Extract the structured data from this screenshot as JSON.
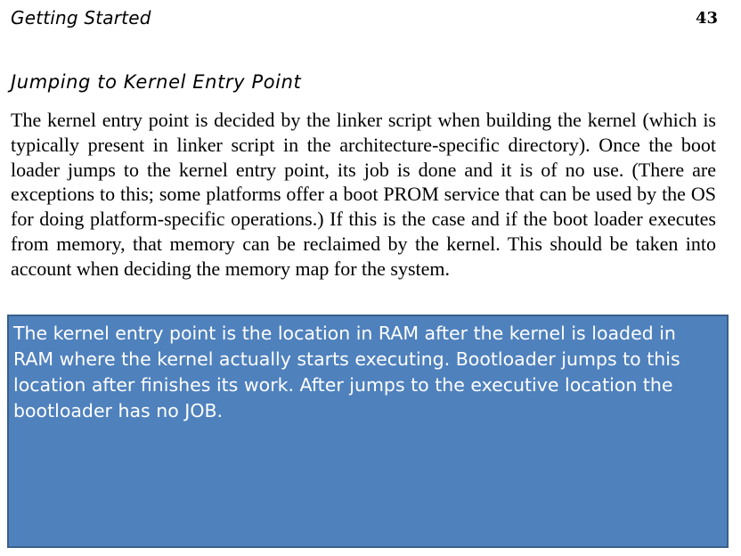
{
  "header": {
    "running_title": "Getting Started",
    "page_number": "43"
  },
  "section": {
    "heading": "Jumping to Kernel Entry Point",
    "body": "The kernel entry point is decided by the linker script when building the kernel (which is typically present in linker script in the architecture-specific directory). Once the boot loader jumps to the kernel entry point, its job is done and it is of no use. (There are exceptions to this; some platforms offer a boot PROM service that can be used by the OS for doing platform-specific operations.) If this is the case and if the boot loader executes from memory, that memory can be reclaimed by the kernel. This should be taken into account when deciding the memory map for the system."
  },
  "note": {
    "text": "The kernel entry point is the location in RAM after the kernel is loaded in RAM where the kernel actually starts executing. Bootloader jumps to this location after finishes its work. After jumps to the executive location the bootloader has no JOB.",
    "background_color": "#4f81bd",
    "text_color": "#ffffff"
  }
}
